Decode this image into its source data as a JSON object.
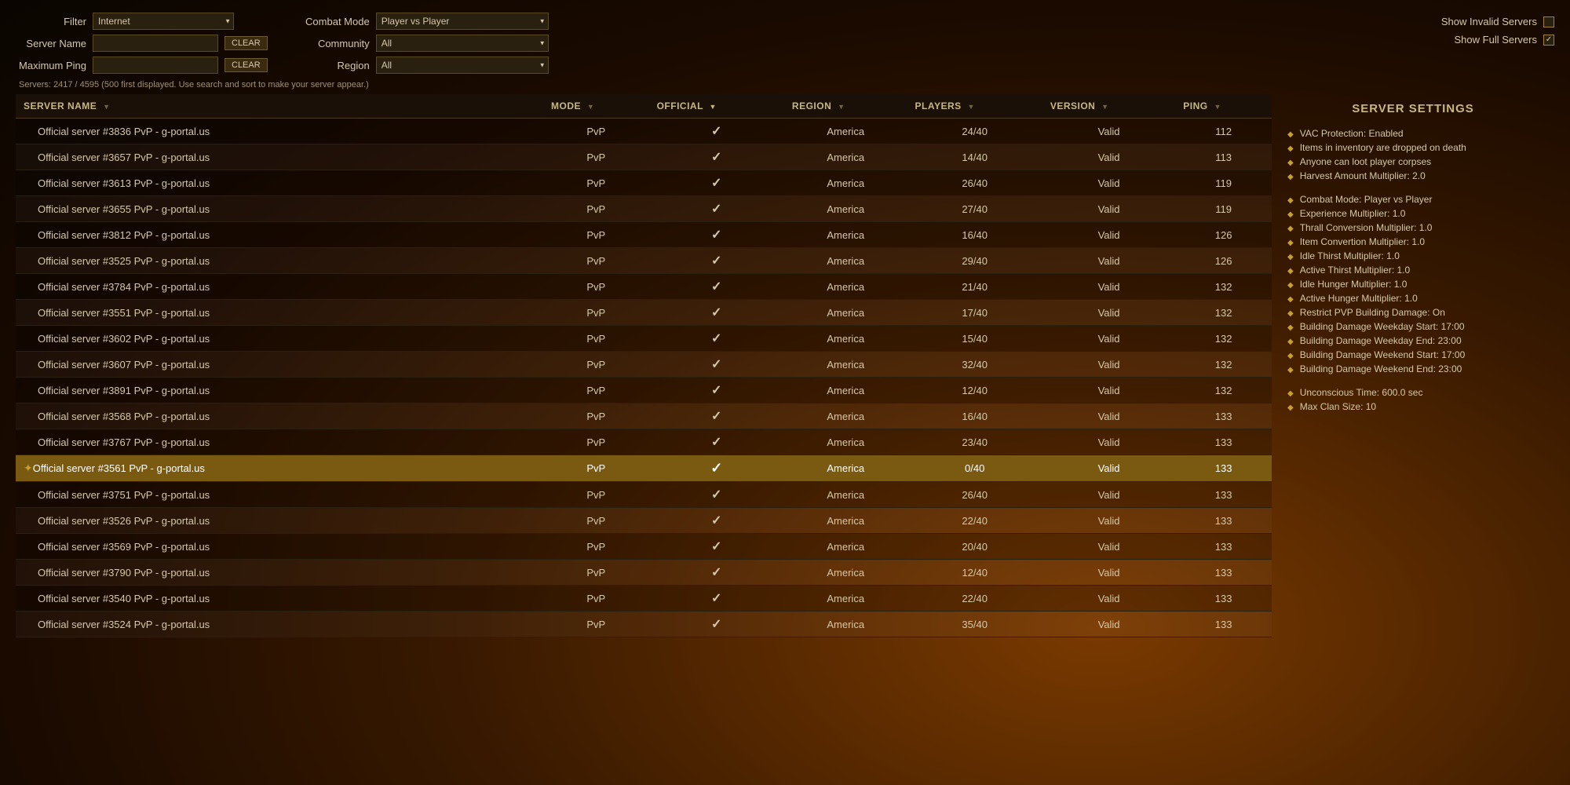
{
  "filters": {
    "filter_label": "Filter",
    "filter_value": "Internet",
    "combat_mode_label": "Combat Mode",
    "combat_mode_value": "Player vs Player",
    "server_name_label": "Server Name",
    "server_name_value": "",
    "server_name_placeholder": "",
    "clear_label": "CLEAR",
    "maximum_ping_label": "Maximum Ping",
    "maximum_ping_value": "",
    "community_label": "Community",
    "community_value": "All",
    "region_label": "Region",
    "region_value": "All",
    "show_invalid_label": "Show Invalid Servers",
    "show_full_label": "Show Full Servers",
    "show_full_checked": true,
    "show_invalid_checked": false
  },
  "server_count_info": "Servers: 2417 / 4595 (500 first displayed. Use search and sort to make your server appear.)",
  "table": {
    "columns": [
      {
        "key": "name",
        "label": "SERVER NAME",
        "sort": "none"
      },
      {
        "key": "mode",
        "label": "MODE",
        "sort": "none"
      },
      {
        "key": "official",
        "label": "OFFICIAL",
        "sort": "desc"
      },
      {
        "key": "region",
        "label": "REGION",
        "sort": "none"
      },
      {
        "key": "players",
        "label": "PLAYERS",
        "sort": "none"
      },
      {
        "key": "version",
        "label": "VERSION",
        "sort": "none"
      },
      {
        "key": "ping",
        "label": "PING",
        "sort": "none"
      }
    ],
    "rows": [
      {
        "name": "Official server #3836 PvP - g-portal.us",
        "mode": "PvP",
        "official": true,
        "region": "America",
        "players": "24/40",
        "version": "Valid",
        "ping": "112",
        "selected": false,
        "starred": false
      },
      {
        "name": "Official server #3657 PvP - g-portal.us",
        "mode": "PvP",
        "official": true,
        "region": "America",
        "players": "14/40",
        "version": "Valid",
        "ping": "113",
        "selected": false,
        "starred": false
      },
      {
        "name": "Official server #3613 PvP - g-portal.us",
        "mode": "PvP",
        "official": true,
        "region": "America",
        "players": "26/40",
        "version": "Valid",
        "ping": "119",
        "selected": false,
        "starred": false
      },
      {
        "name": "Official server #3655 PvP - g-portal.us",
        "mode": "PvP",
        "official": true,
        "region": "America",
        "players": "27/40",
        "version": "Valid",
        "ping": "119",
        "selected": false,
        "starred": false
      },
      {
        "name": "Official server #3812 PvP - g-portal.us",
        "mode": "PvP",
        "official": true,
        "region": "America",
        "players": "16/40",
        "version": "Valid",
        "ping": "126",
        "selected": false,
        "starred": false
      },
      {
        "name": "Official server #3525 PvP - g-portal.us",
        "mode": "PvP",
        "official": true,
        "region": "America",
        "players": "29/40",
        "version": "Valid",
        "ping": "126",
        "selected": false,
        "starred": false
      },
      {
        "name": "Official server #3784 PvP - g-portal.us",
        "mode": "PvP",
        "official": true,
        "region": "America",
        "players": "21/40",
        "version": "Valid",
        "ping": "132",
        "selected": false,
        "starred": false
      },
      {
        "name": "Official server #3551 PvP - g-portal.us",
        "mode": "PvP",
        "official": true,
        "region": "America",
        "players": "17/40",
        "version": "Valid",
        "ping": "132",
        "selected": false,
        "starred": false
      },
      {
        "name": "Official server #3602 PvP - g-portal.us",
        "mode": "PvP",
        "official": true,
        "region": "America",
        "players": "15/40",
        "version": "Valid",
        "ping": "132",
        "selected": false,
        "starred": false
      },
      {
        "name": "Official server #3607 PvP - g-portal.us",
        "mode": "PvP",
        "official": true,
        "region": "America",
        "players": "32/40",
        "version": "Valid",
        "ping": "132",
        "selected": false,
        "starred": false
      },
      {
        "name": "Official server #3891 PvP - g-portal.us",
        "mode": "PvP",
        "official": true,
        "region": "America",
        "players": "12/40",
        "version": "Valid",
        "ping": "132",
        "selected": false,
        "starred": false
      },
      {
        "name": "Official server #3568 PvP - g-portal.us",
        "mode": "PvP",
        "official": true,
        "region": "America",
        "players": "16/40",
        "version": "Valid",
        "ping": "133",
        "selected": false,
        "starred": false
      },
      {
        "name": "Official server #3767 PvP - g-portal.us",
        "mode": "PvP",
        "official": true,
        "region": "America",
        "players": "23/40",
        "version": "Valid",
        "ping": "133",
        "selected": false,
        "starred": false
      },
      {
        "name": "Official server #3561 PvP - g-portal.us",
        "mode": "PvP",
        "official": true,
        "region": "America",
        "players": "0/40",
        "version": "Valid",
        "ping": "133",
        "selected": true,
        "starred": true
      },
      {
        "name": "Official server #3751 PvP - g-portal.us",
        "mode": "PvP",
        "official": true,
        "region": "America",
        "players": "26/40",
        "version": "Valid",
        "ping": "133",
        "selected": false,
        "starred": false
      },
      {
        "name": "Official server #3526 PvP - g-portal.us",
        "mode": "PvP",
        "official": true,
        "region": "America",
        "players": "22/40",
        "version": "Valid",
        "ping": "133",
        "selected": false,
        "starred": false
      },
      {
        "name": "Official server #3569 PvP - g-portal.us",
        "mode": "PvP",
        "official": true,
        "region": "America",
        "players": "20/40",
        "version": "Valid",
        "ping": "133",
        "selected": false,
        "starred": false
      },
      {
        "name": "Official server #3790 PvP - g-portal.us",
        "mode": "PvP",
        "official": true,
        "region": "America",
        "players": "12/40",
        "version": "Valid",
        "ping": "133",
        "selected": false,
        "starred": false
      },
      {
        "name": "Official server #3540 PvP - g-portal.us",
        "mode": "PvP",
        "official": true,
        "region": "America",
        "players": "22/40",
        "version": "Valid",
        "ping": "133",
        "selected": false,
        "starred": false
      },
      {
        "name": "Official server #3524 PvP - g-portal.us",
        "mode": "PvP",
        "official": true,
        "region": "America",
        "players": "35/40",
        "version": "Valid",
        "ping": "133",
        "selected": false,
        "starred": false
      }
    ]
  },
  "server_settings": {
    "title": "SERVER SETTINGS",
    "items": [
      {
        "text": "VAC Protection: Enabled"
      },
      {
        "text": "Items in inventory are dropped on death"
      },
      {
        "text": "Anyone can loot player corpses"
      },
      {
        "text": "Harvest Amount Multiplier: 2.0"
      },
      {
        "divider": true
      },
      {
        "text": "Combat Mode: Player vs Player"
      },
      {
        "text": "Experience Multiplier: 1.0"
      },
      {
        "text": "Thrall Conversion Multiplier: 1.0"
      },
      {
        "text": "Item Convertion Multiplier: 1.0"
      },
      {
        "text": "Idle Thirst Multiplier: 1.0"
      },
      {
        "text": "Active Thirst Multiplier: 1.0"
      },
      {
        "text": "Idle Hunger Multiplier: 1.0"
      },
      {
        "text": "Active Hunger Multiplier: 1.0"
      },
      {
        "text": "Restrict PVP Building Damage: On"
      },
      {
        "text": "Building Damage Weekday Start: 17:00"
      },
      {
        "text": "Building Damage Weekday End: 23:00"
      },
      {
        "text": "Building Damage Weekend Start: 17:00"
      },
      {
        "text": "Building Damage Weekend End: 23:00"
      },
      {
        "divider": true
      },
      {
        "text": "Unconscious Time: 600.0 sec"
      },
      {
        "text": "Max Clan Size: 10"
      }
    ]
  }
}
